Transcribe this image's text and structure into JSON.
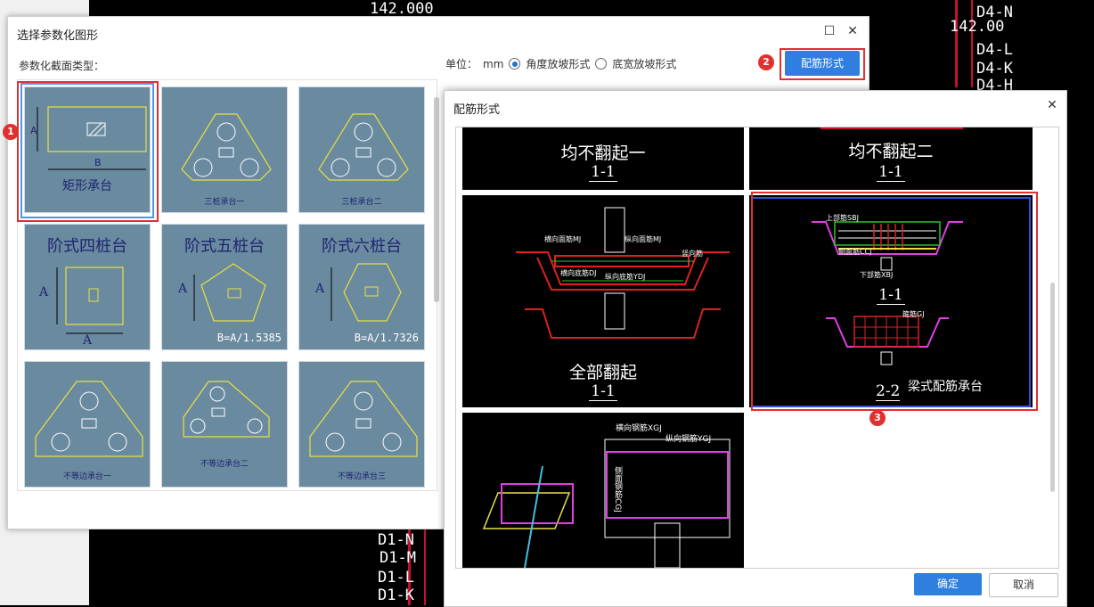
{
  "background": {
    "labels_top": [
      "142.000",
      "142.00"
    ],
    "labels_right": [
      "D4-N",
      "D4-L",
      "D4-K",
      "D4-H"
    ],
    "labels_bottom": [
      "D1-N",
      "D1-M",
      "D1-L",
      "D1-K"
    ]
  },
  "dialog1": {
    "title": "选择参数化图形",
    "section_label": "参数化截面类型：",
    "unit_label": "单位：",
    "unit_value": "mm",
    "radio_angle": "角度放坡形式",
    "radio_width": "底宽放坡形式",
    "rebar_button": "配筋形式",
    "tiles": [
      {
        "title": "",
        "caption": "矩形承台",
        "dim_a": "A",
        "dim_b": "B"
      },
      {
        "title": "",
        "caption": "三桩承台一"
      },
      {
        "title": "",
        "caption": "三桩承台二"
      },
      {
        "title": "阶式四桩台",
        "caption": "A",
        "dim_a": "A"
      },
      {
        "title": "阶式五桩台",
        "caption": "B=A/1.5385",
        "dim_a": "A"
      },
      {
        "title": "阶式六桩台",
        "caption": "B=A/1.7326",
        "dim_a": "A"
      },
      {
        "title": "",
        "caption": "不等边承台一"
      },
      {
        "title": "",
        "caption": "不等边承台二"
      },
      {
        "title": "",
        "caption": "不等边承台三"
      }
    ],
    "badges": [
      "1",
      "2"
    ]
  },
  "dialog2": {
    "title": "配筋形式",
    "tiles": [
      {
        "caption": "均不翻起一",
        "sub": "1-1"
      },
      {
        "caption": "均不翻起二",
        "sub": "1-1"
      },
      {
        "caption": "全部翻起",
        "sub": "1-1",
        "labels": [
          "横向面筋MJ",
          "纵向面筋MJ",
          "横向底筋DJ",
          "纵向底筋YDJ",
          "竖向筋"
        ]
      },
      {
        "caption": "梁式配筋承台",
        "sub": "1-1",
        "sub2": "2-2",
        "labels": [
          "上部筋SBJ",
          "侧面筋CCJ",
          "下部筋XBJ",
          "箍筋GJ"
        ]
      },
      {
        "caption": "",
        "labels": [
          "横向钢筋XGJ",
          "纵向钢筋YGJ",
          "侧面钢筋CGJ"
        ]
      }
    ],
    "badge": "3",
    "ok": "确定",
    "cancel": "取消"
  }
}
